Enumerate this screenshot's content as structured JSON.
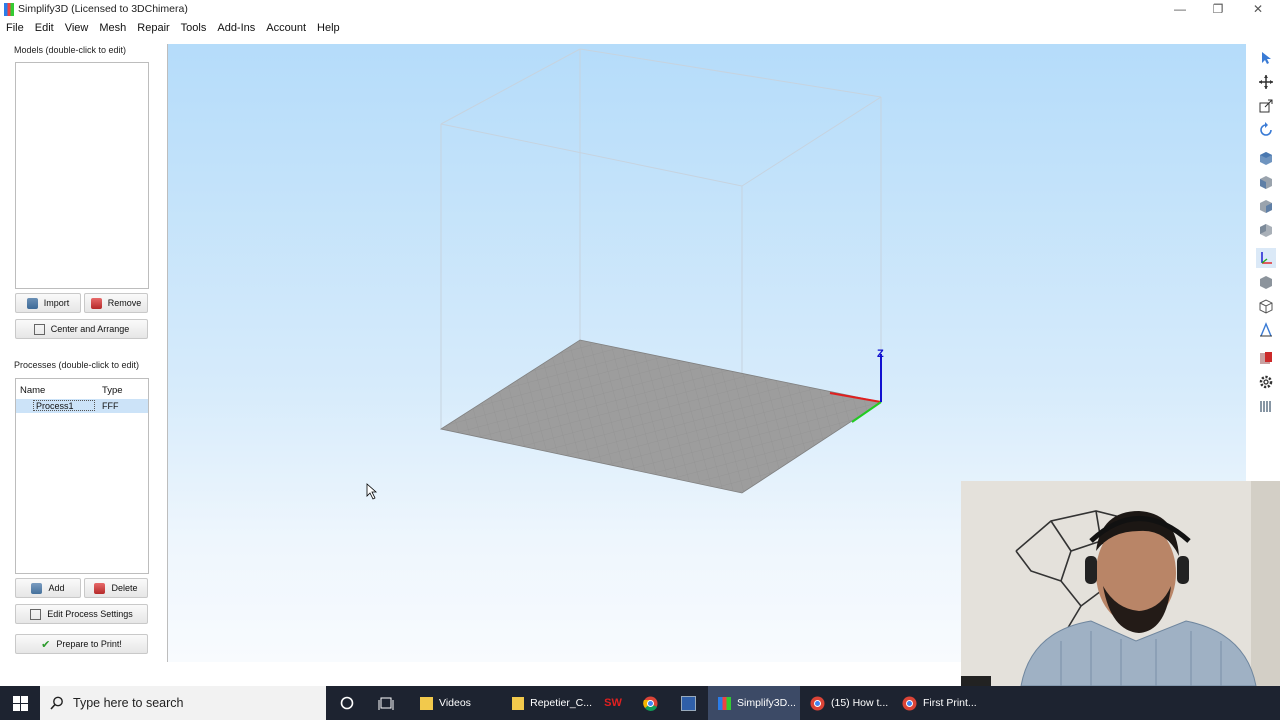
{
  "window": {
    "title": "Simplify3D (Licensed to 3DChimera)",
    "controls": [
      "—",
      "❐",
      "✕"
    ]
  },
  "menu": [
    "File",
    "Edit",
    "View",
    "Mesh",
    "Repair",
    "Tools",
    "Add-Ins",
    "Account",
    "Help"
  ],
  "models": {
    "label": "Models (double-click to edit)",
    "import_label": "Import",
    "remove_label": "Remove",
    "center_label": "Center and Arrange"
  },
  "processes": {
    "label": "Processes (double-click to edit)",
    "columns": [
      "Name",
      "Type"
    ],
    "rows": [
      {
        "name": "Process1",
        "type": "FFF"
      }
    ],
    "add_label": "Add",
    "delete_label": "Delete",
    "edit_label": "Edit Process Settings",
    "prepare_label": "Prepare to Print!"
  },
  "viewport": {
    "z_axis_label": "Z",
    "axis_colors": {
      "x": "#e02020",
      "y": "#22cc22",
      "z": "#1010d0"
    },
    "background_top": "#b5dcfa"
  },
  "toolbar_icons": [
    "select-icon",
    "move-icon",
    "scale-icon",
    "rotate-icon",
    "view-top-icon",
    "view-front-icon",
    "view-right-icon",
    "view-left-icon",
    "axes-icon",
    "solid-view-icon",
    "wireframe-view-icon",
    "cross-section-icon",
    "repair-icon",
    "settings-icon",
    "layers-icon"
  ],
  "taskbar": {
    "search_placeholder": "Type here to search",
    "items": [
      "Videos",
      "Repetier_C...",
      "Simplify3D...",
      "(15) How t...",
      "First Print..."
    ]
  }
}
